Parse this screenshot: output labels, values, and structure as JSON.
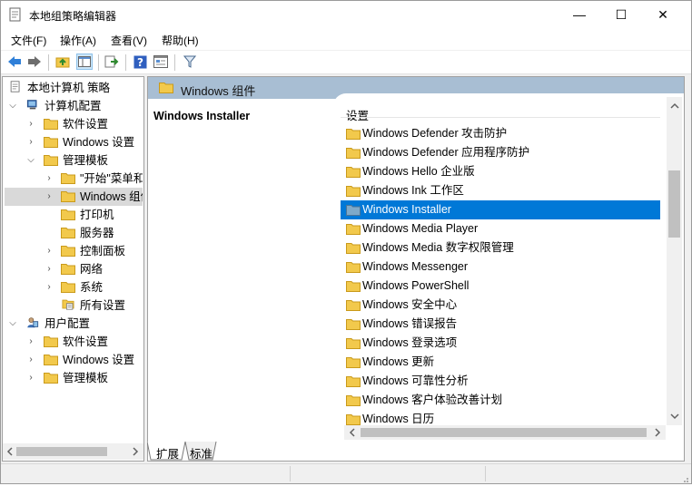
{
  "window": {
    "title": "本地组策略编辑器",
    "minimize_glyph": "—",
    "maximize_glyph": "☐",
    "close_glyph": "✕"
  },
  "menu": [
    "文件(F)",
    "操作(A)",
    "查看(V)",
    "帮助(H)"
  ],
  "toolbar": {
    "icons": [
      "back-arrow-icon",
      "forward-arrow-icon",
      "up-folder-icon",
      "show-hide-tree-icon",
      "export-list-icon",
      "help-icon",
      "properties-icon",
      "filter-icon"
    ]
  },
  "tree": {
    "items": [
      {
        "label": "本地计算机 策略",
        "icon": "policy-icon"
      },
      {
        "label": "计算机配置",
        "icon": "computer-icon"
      },
      {
        "label": "软件设置",
        "icon": "folder-icon"
      },
      {
        "label": "Windows 设置",
        "icon": "folder-icon"
      },
      {
        "label": "管理模板",
        "icon": "folder-icon"
      },
      {
        "label": "\"开始\"菜单和",
        "icon": "folder-icon"
      },
      {
        "label": "Windows 组件",
        "icon": "folder-icon"
      },
      {
        "label": "打印机",
        "icon": "folder-icon"
      },
      {
        "label": "服务器",
        "icon": "folder-icon"
      },
      {
        "label": "控制面板",
        "icon": "folder-icon"
      },
      {
        "label": "网络",
        "icon": "folder-icon"
      },
      {
        "label": "系统",
        "icon": "folder-icon"
      },
      {
        "label": "所有设置",
        "icon": "settings-folder-icon"
      },
      {
        "label": "用户配置",
        "icon": "user-icon"
      },
      {
        "label": "软件设置",
        "icon": "folder-icon"
      },
      {
        "label": "Windows 设置",
        "icon": "folder-icon"
      },
      {
        "label": "管理模板",
        "icon": "folder-icon"
      }
    ]
  },
  "detail": {
    "header": "Windows 组件",
    "selected_name": "Windows Installer",
    "column_header": "设置",
    "items": [
      "Windows Defender 攻击防护",
      "Windows Defender 应用程序防护",
      "Windows Hello 企业版",
      "Windows Ink 工作区",
      "Windows Installer",
      "Windows Media Player",
      "Windows Media 数字权限管理",
      "Windows Messenger",
      "Windows PowerShell",
      "Windows 安全中心",
      "Windows 错误报告",
      "Windows 登录选项",
      "Windows 更新",
      "Windows 可靠性分析",
      "Windows 客户体验改善计划",
      "Windows 日历"
    ]
  },
  "tabs": [
    "扩展",
    "标准"
  ],
  "colors": {
    "selection": "#0078d7",
    "header_band": "#a8bed3",
    "folder": "#f2c94c"
  }
}
